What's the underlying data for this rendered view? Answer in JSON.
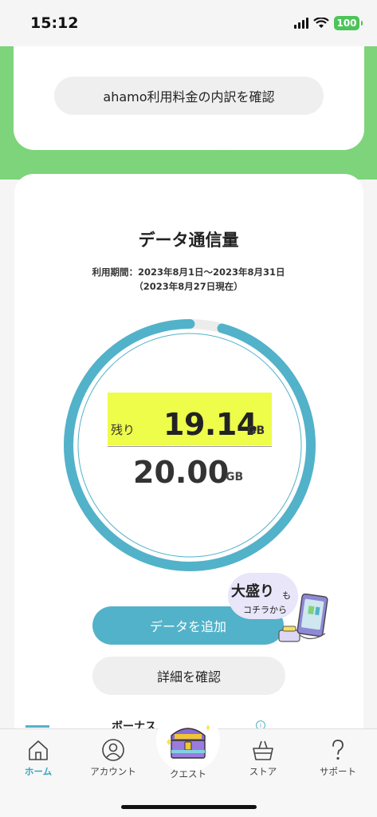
{
  "status_bar": {
    "time": "15:12",
    "battery": "100"
  },
  "top_card": {
    "breakdown_button": "ahamo利用料金の内訳を確認"
  },
  "data_usage": {
    "title": "データ通信量",
    "period_line1": "利用期間：2023年8月1日〜2023年8月31日",
    "period_line2": "（2023年8月27日現在）",
    "remaining_label": "残り",
    "remaining_value": "19.14",
    "remaining_unit": "GB",
    "total_value": "20.00",
    "total_unit": "GB",
    "remaining_fraction": 0.957
  },
  "buttons": {
    "add_data": "データを追加",
    "details": "詳細を確認"
  },
  "promo": {
    "big_text": "大盛り",
    "small_mo": "も",
    "small_text": "コチラから"
  },
  "bonus": {
    "text": "ボーナス"
  },
  "tabs": [
    {
      "label": "ホーム",
      "icon": "home-icon",
      "active": true
    },
    {
      "label": "アカウント",
      "icon": "account-icon",
      "active": false
    },
    {
      "label": "クエスト",
      "icon": "treasure-chest-icon",
      "active": false
    },
    {
      "label": "ストア",
      "icon": "basket-icon",
      "active": false
    },
    {
      "label": "サポート",
      "icon": "question-icon",
      "active": false
    }
  ],
  "colors": {
    "accent": "#52b2c9",
    "green_band": "#7dd47a",
    "highlight": "#eefc4a",
    "active_tab": "#3aa5bd"
  }
}
